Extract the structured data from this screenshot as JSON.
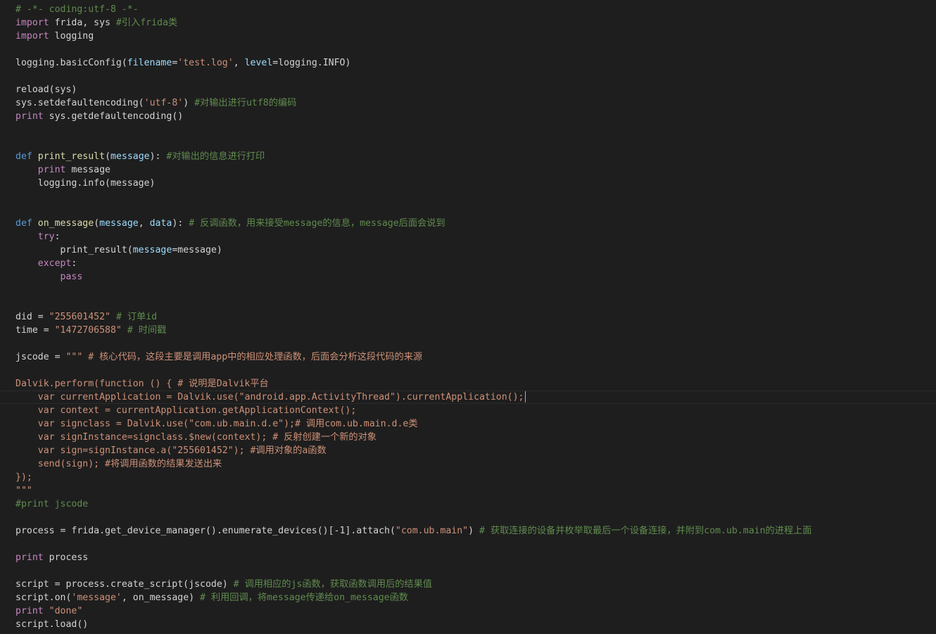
{
  "editor": {
    "language": "python",
    "current_line": 29,
    "lines": [
      {
        "segments": [
          {
            "t": "# -*- coding:utf-8 -*-",
            "c": "cmt"
          }
        ]
      },
      {
        "segments": [
          {
            "t": "import",
            "c": "ctl"
          },
          {
            "t": " frida, sys ",
            "c": ""
          },
          {
            "t": "#引入frida类",
            "c": "cmt"
          }
        ]
      },
      {
        "segments": [
          {
            "t": "import",
            "c": "ctl"
          },
          {
            "t": " logging",
            "c": ""
          }
        ]
      },
      {
        "segments": []
      },
      {
        "segments": [
          {
            "t": "logging.basicConfig(",
            "c": ""
          },
          {
            "t": "filename",
            "c": "param"
          },
          {
            "t": "=",
            "c": ""
          },
          {
            "t": "'test.log'",
            "c": "str"
          },
          {
            "t": ", ",
            "c": ""
          },
          {
            "t": "level",
            "c": "param"
          },
          {
            "t": "=logging.INFO)",
            "c": ""
          }
        ]
      },
      {
        "segments": []
      },
      {
        "segments": [
          {
            "t": "reload(sys)",
            "c": ""
          }
        ]
      },
      {
        "segments": [
          {
            "t": "sys.setdefaultencoding(",
            "c": ""
          },
          {
            "t": "'utf-8'",
            "c": "str"
          },
          {
            "t": ") ",
            "c": ""
          },
          {
            "t": "#对输出进行utf8的编码",
            "c": "cmt"
          }
        ]
      },
      {
        "segments": [
          {
            "t": "print",
            "c": "ctl"
          },
          {
            "t": " sys.getdefaultencoding()",
            "c": ""
          }
        ]
      },
      {
        "segments": []
      },
      {
        "segments": []
      },
      {
        "segments": [
          {
            "t": "def",
            "c": "kw"
          },
          {
            "t": " ",
            "c": ""
          },
          {
            "t": "print_result",
            "c": "fn"
          },
          {
            "t": "(",
            "c": ""
          },
          {
            "t": "message",
            "c": "param"
          },
          {
            "t": "): ",
            "c": ""
          },
          {
            "t": "#对输出的信息进行打印",
            "c": "cmt"
          }
        ]
      },
      {
        "segments": [
          {
            "t": "    ",
            "c": ""
          },
          {
            "t": "print",
            "c": "ctl"
          },
          {
            "t": " message",
            "c": ""
          }
        ]
      },
      {
        "segments": [
          {
            "t": "    logging.info(message)",
            "c": ""
          }
        ]
      },
      {
        "segments": []
      },
      {
        "segments": []
      },
      {
        "segments": [
          {
            "t": "def",
            "c": "kw"
          },
          {
            "t": " ",
            "c": ""
          },
          {
            "t": "on_message",
            "c": "fn"
          },
          {
            "t": "(",
            "c": ""
          },
          {
            "t": "message",
            "c": "param"
          },
          {
            "t": ", ",
            "c": ""
          },
          {
            "t": "data",
            "c": "param"
          },
          {
            "t": "): ",
            "c": ""
          },
          {
            "t": "# 反调函数，用来接受message的信息，message后面会说到",
            "c": "cmt"
          }
        ]
      },
      {
        "segments": [
          {
            "t": "    ",
            "c": ""
          },
          {
            "t": "try",
            "c": "ctl"
          },
          {
            "t": ":",
            "c": ""
          }
        ]
      },
      {
        "segments": [
          {
            "t": "        print_result(",
            "c": ""
          },
          {
            "t": "message",
            "c": "param"
          },
          {
            "t": "=message)",
            "c": ""
          }
        ]
      },
      {
        "segments": [
          {
            "t": "    ",
            "c": ""
          },
          {
            "t": "except",
            "c": "ctl"
          },
          {
            "t": ":",
            "c": ""
          }
        ]
      },
      {
        "segments": [
          {
            "t": "        ",
            "c": ""
          },
          {
            "t": "pass",
            "c": "ctl"
          }
        ]
      },
      {
        "segments": []
      },
      {
        "segments": []
      },
      {
        "segments": [
          {
            "t": "did = ",
            "c": ""
          },
          {
            "t": "\"255601452\"",
            "c": "str"
          },
          {
            "t": " ",
            "c": ""
          },
          {
            "t": "# 订单id",
            "c": "cmt"
          }
        ]
      },
      {
        "segments": [
          {
            "t": "time = ",
            "c": ""
          },
          {
            "t": "\"1472706588\"",
            "c": "str"
          },
          {
            "t": " ",
            "c": ""
          },
          {
            "t": "# 时间戳",
            "c": "cmt"
          }
        ]
      },
      {
        "segments": []
      },
      {
        "segments": [
          {
            "t": "jscode = ",
            "c": ""
          },
          {
            "t": "\"\"\" # 核心代码，这段主要是调用app中的相应处理函数，后面会分析这段代码的来源",
            "c": "jsstr"
          }
        ]
      },
      {
        "segments": []
      },
      {
        "segments": [
          {
            "t": "Dalvik.perform(function () { # 说明是Dalvik平台",
            "c": "jsstr"
          }
        ]
      },
      {
        "segments": [
          {
            "t": "    var currentApplication = Dalvik.use(\"android.app.ActivityThread\").currentApplication();",
            "c": "jsstr"
          }
        ],
        "caret": true
      },
      {
        "segments": [
          {
            "t": "    var context = currentApplication.getApplicationContext();",
            "c": "jsstr"
          }
        ]
      },
      {
        "segments": [
          {
            "t": "    var signclass = Dalvik.use(\"com.ub.main.d.e\");# 调用com.ub.main.d.e类",
            "c": "jsstr"
          }
        ]
      },
      {
        "segments": [
          {
            "t": "    var signInstance=signclass.$new(context); # 反射创建一个新的对象",
            "c": "jsstr"
          }
        ]
      },
      {
        "segments": [
          {
            "t": "    var sign=signInstance.a(\"255601452\"); #调用对象的a函数",
            "c": "jsstr"
          }
        ]
      },
      {
        "segments": [
          {
            "t": "    send(sign); #将调用函数的结果发送出来",
            "c": "jsstr"
          }
        ]
      },
      {
        "segments": [
          {
            "t": "});",
            "c": "jsstr"
          }
        ]
      },
      {
        "segments": [
          {
            "t": "\"\"\"",
            "c": "jsstr"
          }
        ]
      },
      {
        "segments": [
          {
            "t": "#print jscode",
            "c": "cmt"
          }
        ]
      },
      {
        "segments": []
      },
      {
        "segments": [
          {
            "t": "process = frida.get_device_manager().enumerate_devices()[-1].attach(",
            "c": ""
          },
          {
            "t": "\"com.ub.main\"",
            "c": "str"
          },
          {
            "t": ") ",
            "c": ""
          },
          {
            "t": "# 获取连接的设备并枚举取最后一个设备连接，并附到com.ub.main的进程上面",
            "c": "cmt"
          }
        ]
      },
      {
        "segments": []
      },
      {
        "segments": [
          {
            "t": "print",
            "c": "ctl"
          },
          {
            "t": " process",
            "c": ""
          }
        ]
      },
      {
        "segments": []
      },
      {
        "segments": [
          {
            "t": "script = process.create_script(jscode) ",
            "c": ""
          },
          {
            "t": "# 调用相应的js函数，获取函数调用后的结果值",
            "c": "cmt"
          }
        ]
      },
      {
        "segments": [
          {
            "t": "script.on(",
            "c": ""
          },
          {
            "t": "'message'",
            "c": "str"
          },
          {
            "t": ", on_message) ",
            "c": ""
          },
          {
            "t": "# 利用回调，将message传递给on_message函数",
            "c": "cmt"
          }
        ]
      },
      {
        "segments": [
          {
            "t": "print",
            "c": "ctl"
          },
          {
            "t": " ",
            "c": ""
          },
          {
            "t": "\"done\"",
            "c": "str"
          }
        ]
      },
      {
        "segments": [
          {
            "t": "script.load()",
            "c": ""
          }
        ]
      }
    ]
  }
}
